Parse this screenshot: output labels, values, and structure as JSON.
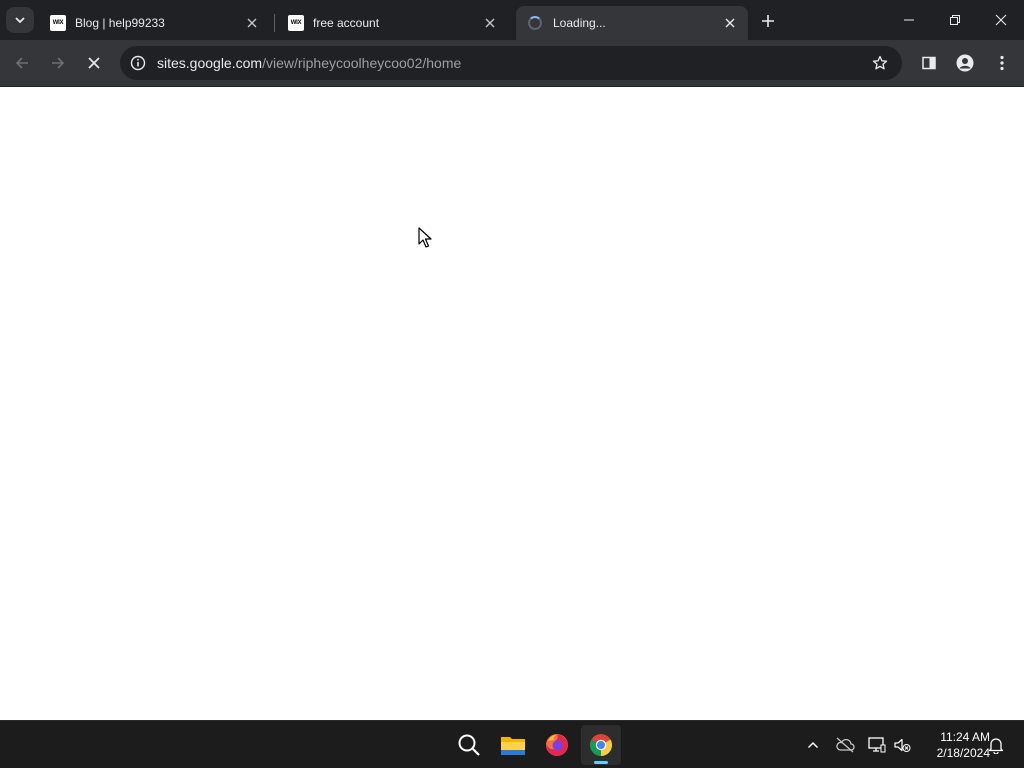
{
  "browser": {
    "tabs": [
      {
        "title": "Blog | help99233",
        "favicon": "WIX",
        "active": false
      },
      {
        "title": "free account",
        "favicon": "WIX",
        "active": false
      },
      {
        "title": "Loading...",
        "favicon": "loading-spinner",
        "active": true
      }
    ],
    "address_bar": {
      "host": "sites.google.com",
      "path": "/view/ripheycoolheycoo02/home"
    }
  },
  "taskbar": {
    "apps": [
      "search-icon",
      "file-explorer-icon",
      "firefox-icon",
      "chrome-icon"
    ],
    "active_app": "chrome",
    "clock": {
      "time": "11:24 AM",
      "date": "2/18/2024"
    }
  },
  "colors": {
    "tab_strip": "#202124",
    "toolbar": "#35363a",
    "taskbar": "#1c1c1c",
    "taskbar_indicator": "#60cdff"
  }
}
